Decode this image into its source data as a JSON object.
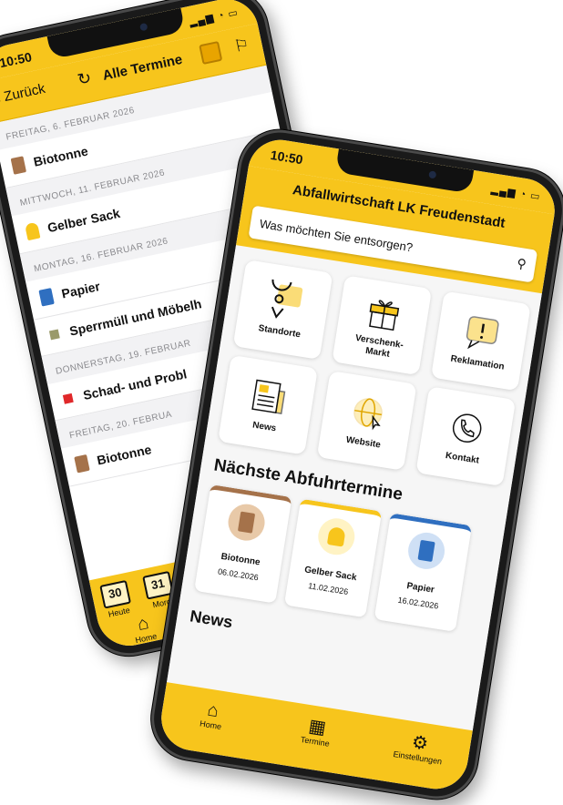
{
  "colors": {
    "accent": "#f7c51c",
    "biotonne": "#a5724a",
    "gelber_sack": "#f7c51c",
    "papier": "#2f6fc0",
    "sperrmuell": "#9a9a6a",
    "schadstoff": "#e0282a"
  },
  "back_phone": {
    "status_time": "10:50",
    "nav": {
      "back_label": "Zurück",
      "title": "Alle Termine"
    },
    "days": [
      {
        "date": "FREITAG, 6. FEBRUAR 2026",
        "items": [
          {
            "label": "Biotonne",
            "icon": "biotonne-icon"
          }
        ]
      },
      {
        "date": "MITTWOCH, 11. FEBRUAR 2026",
        "items": [
          {
            "label": "Gelber Sack",
            "icon": "gelber-sack-icon"
          }
        ]
      },
      {
        "date": "MONTAG, 16. FEBRUAR 2026",
        "items": [
          {
            "label": "Papier",
            "icon": "papier-icon"
          },
          {
            "label": "Sperrmüll und Möbelh",
            "icon": "sperrmuell-icon"
          }
        ]
      },
      {
        "date": "DONNERSTAG, 19. FEBRUAR",
        "items": [
          {
            "label": "Schad- und Probl",
            "icon": "schadstoff-icon"
          }
        ]
      },
      {
        "date": "FREITAG, 20. FEBRUA",
        "items": [
          {
            "label": "Biotonne",
            "icon": "biotonne-icon"
          }
        ]
      }
    ],
    "tabbar": {
      "today_num": "30",
      "today_label": "Heute",
      "tomorrow_num": "31",
      "tomorrow_label": "Morg",
      "home_label": "Home"
    }
  },
  "front_phone": {
    "status_time": "10:50",
    "title": "Abfallwirtschaft LK Freudenstadt",
    "search_placeholder": "Was möchten Sie entsorgen?",
    "tiles": [
      {
        "label": "Standorte",
        "icon": "map-pin-icon"
      },
      {
        "label": "Verschenk-\nMarkt",
        "icon": "gift-icon"
      },
      {
        "label": "Reklamation",
        "icon": "alert-bubble-icon"
      },
      {
        "label": "News",
        "icon": "newspaper-icon"
      },
      {
        "label": "Website",
        "icon": "globe-icon"
      },
      {
        "label": "Kontakt",
        "icon": "phone-icon"
      }
    ],
    "pickups_title": "Nächste Abfuhrtermine",
    "pickups": [
      {
        "name": "Biotonne",
        "date": "06.02.2026",
        "color": "#a5724a"
      },
      {
        "name": "Gelber Sack",
        "date": "11.02.2026",
        "color": "#f7c51c"
      },
      {
        "name": "Papier",
        "date": "16.02.2026",
        "color": "#2f6fc0"
      }
    ],
    "news_title": "News",
    "tabbar": {
      "home": "Home",
      "termine": "Termine",
      "einstellungen": "Einstellungen"
    }
  }
}
